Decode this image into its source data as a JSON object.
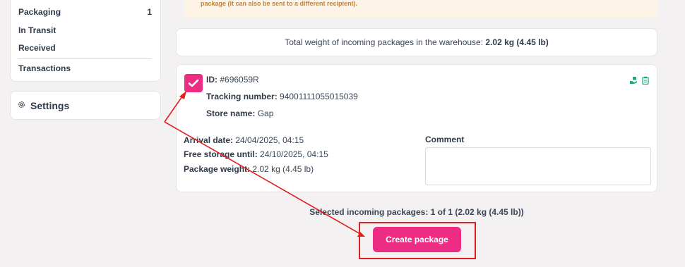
{
  "sidebar": {
    "items": [
      {
        "label": "Packaging",
        "count": "1"
      },
      {
        "label": "In Transit",
        "count": ""
      },
      {
        "label": "Received",
        "count": ""
      },
      {
        "label": "Transactions",
        "count": ""
      }
    ],
    "settings_label": "Settings"
  },
  "notice": {
    "text": "package (it can also be sent to a different recipient)."
  },
  "summary": {
    "label": "Total weight of incoming packages in the warehouse:",
    "value": "2.02 kg (4.45 lb)"
  },
  "package": {
    "checked": true,
    "id_label": "ID:",
    "id_value": "#696059R",
    "tracking_label": "Tracking number:",
    "tracking_value": "94001111055015039",
    "store_label": "Store name:",
    "store_value": "Gap",
    "arrival_label": "Arrival date:",
    "arrival_value": "24/04/2025, 04:15",
    "storage_label": "Free storage until:",
    "storage_value": "24/10/2025, 04:15",
    "weight_label": "Package weight:",
    "weight_value": "2.02 kg (4.45 lb)",
    "comment_label": "Comment",
    "comment_value": "",
    "icons": [
      "hand-package-icon",
      "clipboard-icon"
    ]
  },
  "footer": {
    "selected_text": "Selected incoming packages: 1 of 1 (2.02 kg (4.45 lb))",
    "create_button": "Create package"
  },
  "colors": {
    "accent": "#ec2d83",
    "annotation": "#e0201f",
    "icon_green": "#1aaa7a",
    "notice_bg": "#fdf3e6",
    "notice_text": "#c9822a"
  }
}
